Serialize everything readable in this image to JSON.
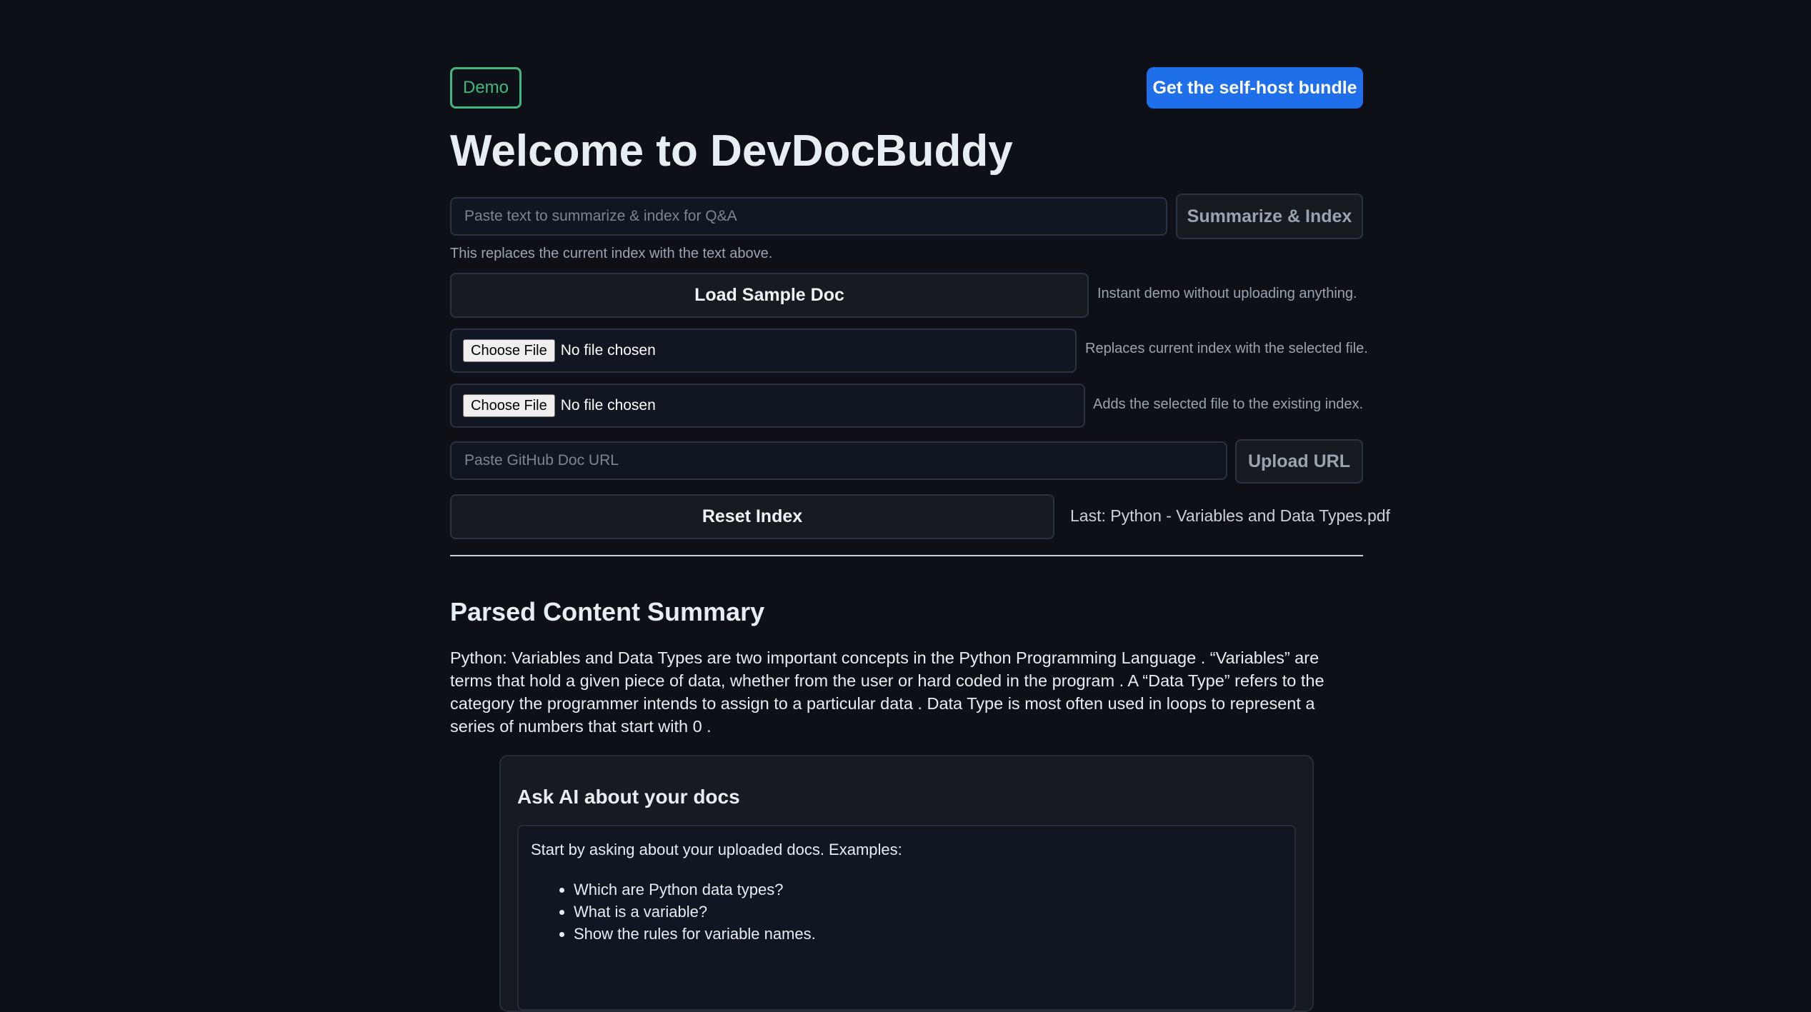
{
  "header": {
    "badge": "Demo",
    "cta": "Get the self-host bundle",
    "title": "Welcome to DevDocBuddy"
  },
  "summarize": {
    "placeholder": "Paste text to summarize & index for Q&A",
    "button": "Summarize & Index",
    "hint": "This replaces the current index with the text above."
  },
  "sample": {
    "button": "Load Sample Doc",
    "hint": "Instant demo without uploading anything."
  },
  "file_replace": {
    "choose": "Choose File",
    "status": "No file chosen",
    "hint": "Replaces current index with the selected file."
  },
  "file_add": {
    "choose": "Choose File",
    "status": "No file chosen",
    "hint": "Adds the selected file to the existing index."
  },
  "url": {
    "placeholder": "Paste GitHub Doc URL",
    "button": "Upload URL"
  },
  "reset": {
    "button": "Reset Index",
    "last": "Last: Python - Variables and Data Types.pdf"
  },
  "summary": {
    "heading": "Parsed Content Summary",
    "text": "Python: Variables and Data Types are two important concepts in the Python Programming Language . “Variables” are terms that hold a given piece of data, whether from the user or hard coded in the program . A “Data Type” refers to the category the programmer intends to assign to a particular data . Data Type is most often used in loops to represent a series of numbers that start with 0 ."
  },
  "ask": {
    "title": "Ask AI about your docs",
    "intro": "Start by asking about your uploaded docs. Examples:",
    "examples": [
      "Which are Python data types?",
      "What is a variable?",
      "Show the rules for variable names."
    ]
  },
  "colors": {
    "background": "#0d1117",
    "accent": "#1f6feb",
    "badge": "#3fb97f"
  }
}
